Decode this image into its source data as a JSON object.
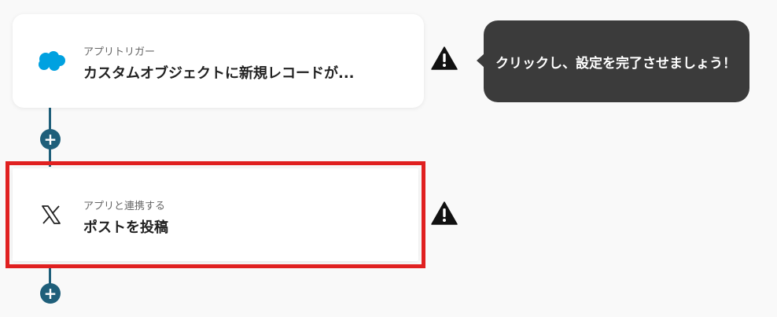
{
  "flow": {
    "steps": [
      {
        "subtitle": "アプリトリガー",
        "title": "カスタムオブジェクトに新規レコードが...",
        "app_icon": "salesforce-cloud-icon"
      },
      {
        "subtitle": "アプリと連携する",
        "title": "ポストを投稿",
        "app_icon": "x-logo-icon"
      }
    ],
    "add_step_symbol": "+",
    "warning_icon": "warning-triangle-icon"
  },
  "tooltip": {
    "text": "クリックし、設定を完了させましょう！"
  },
  "colors": {
    "connector": "#1f5f7a",
    "highlight_border": "#e02020",
    "tooltip_bg": "#3b3b3b",
    "salesforce_blue": "#00a1e0",
    "background": "#f9f9f9"
  }
}
